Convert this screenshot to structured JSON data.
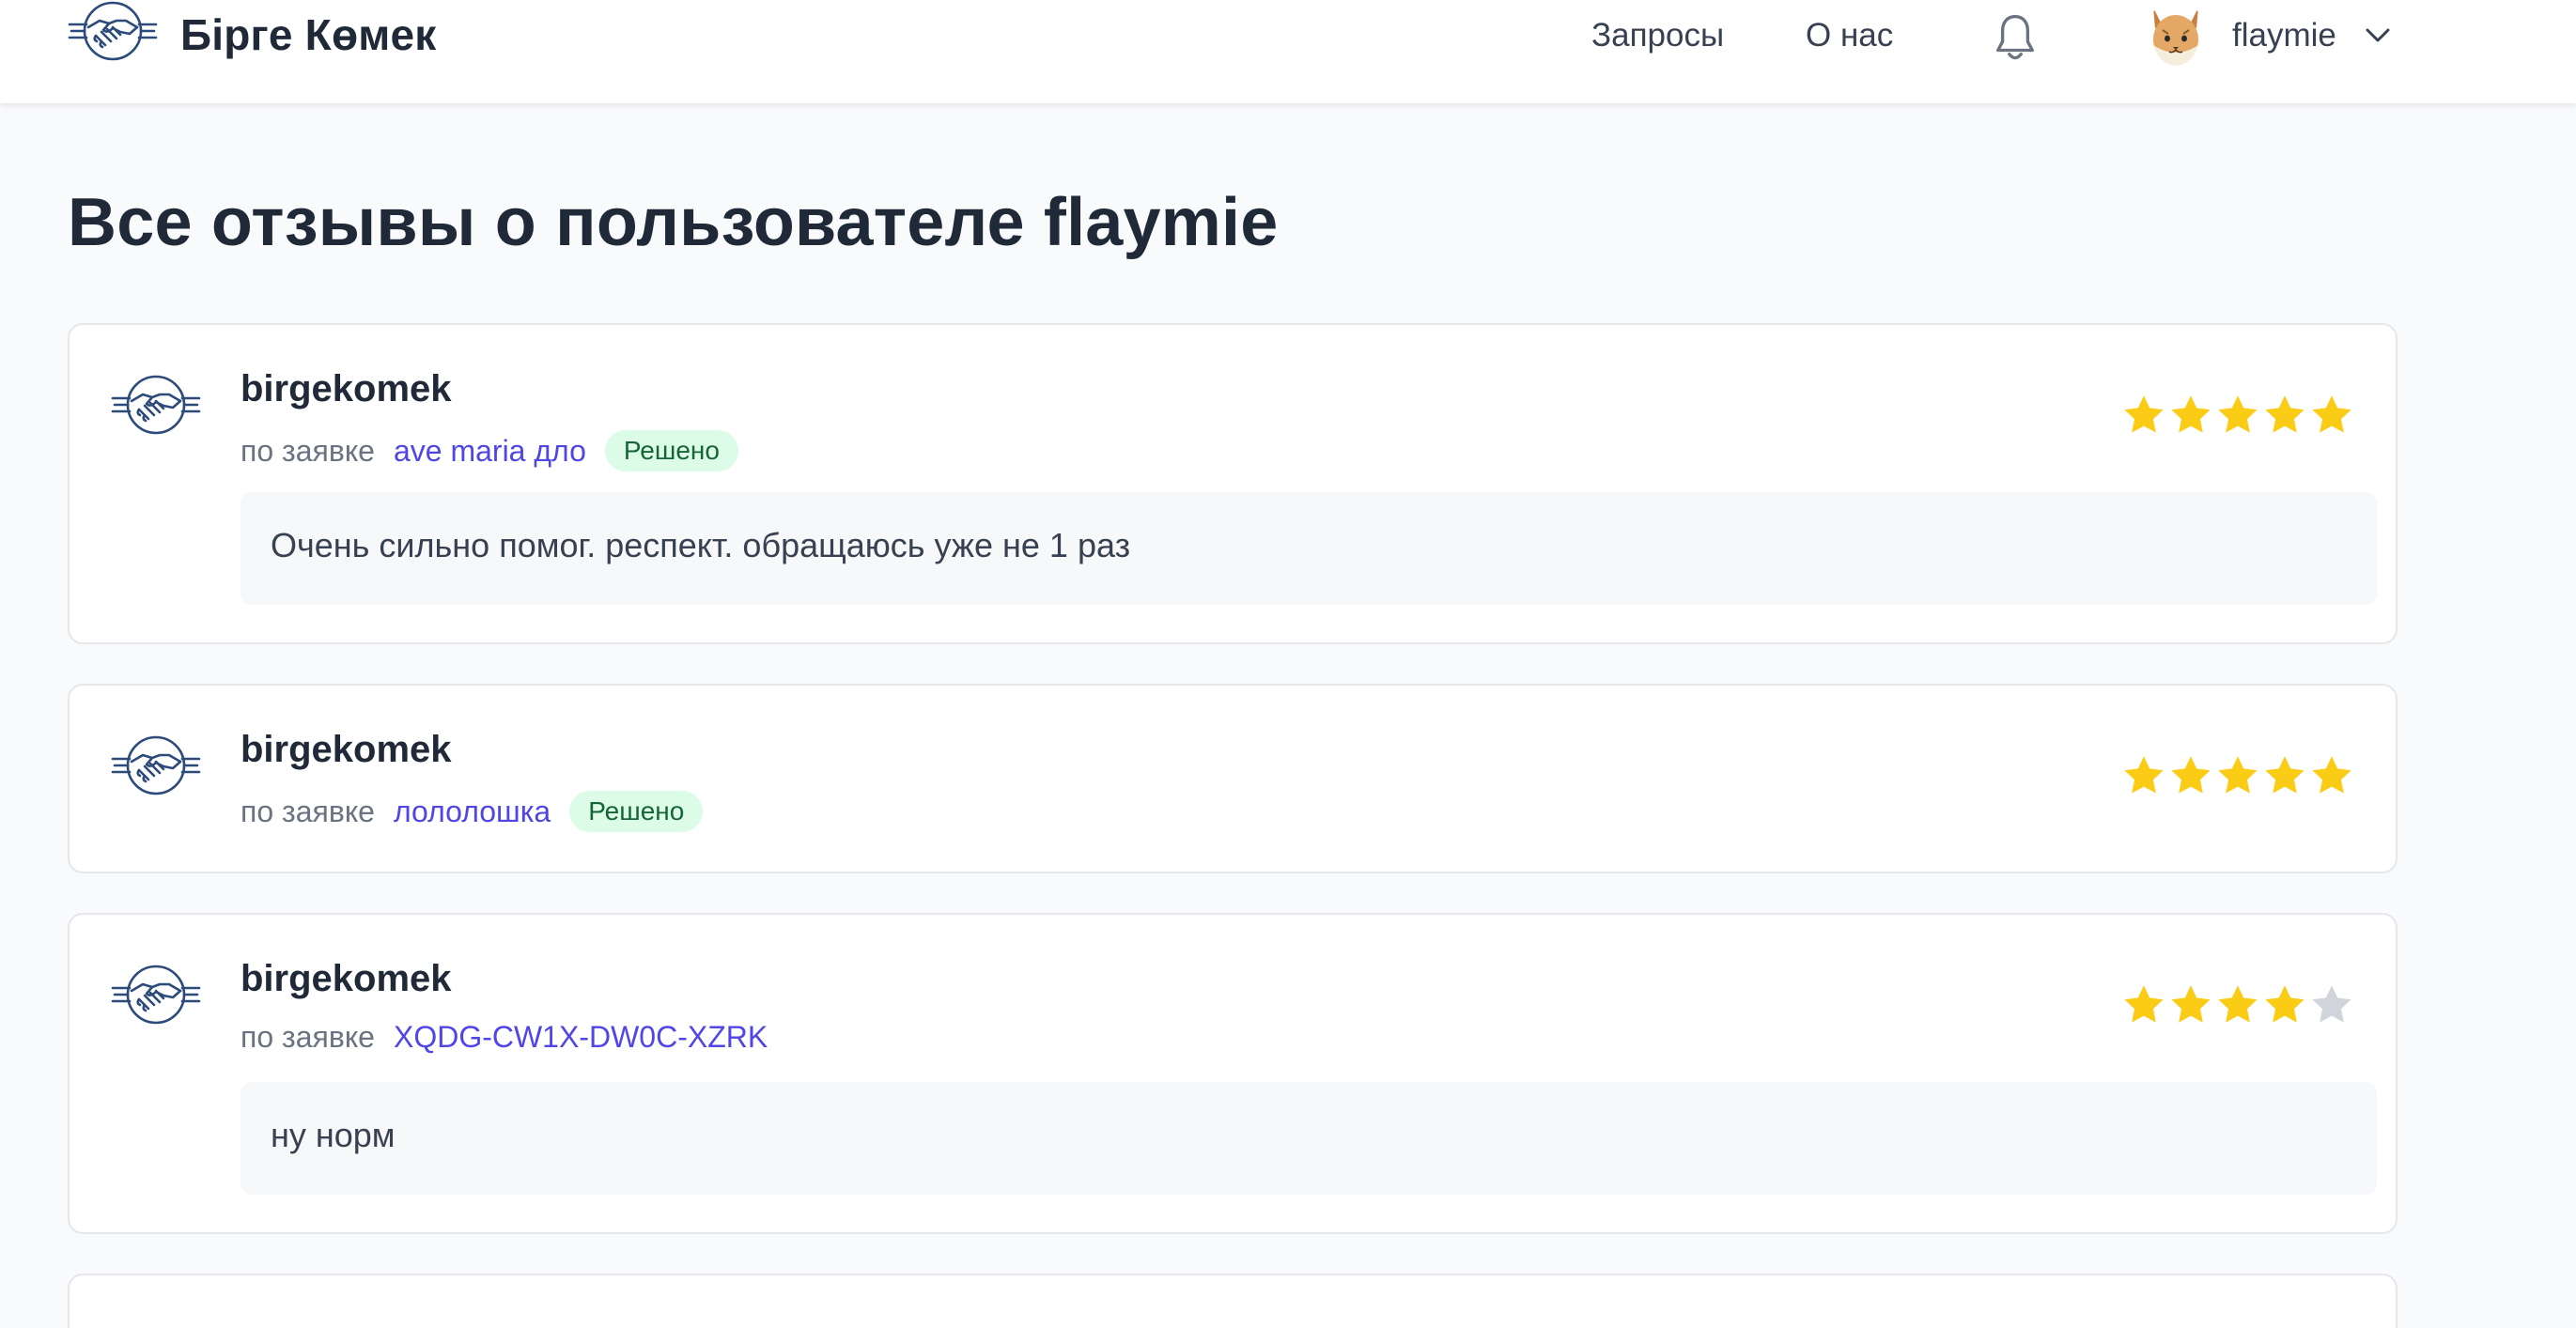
{
  "header": {
    "brand": "Бірге Көмек",
    "logo_icon": "handshake-logo-icon",
    "nav": [
      {
        "label": "Запросы"
      },
      {
        "label": "О нас"
      }
    ],
    "notification_icon": "bell-icon",
    "user": {
      "name": "flaymie",
      "avatar_icon": "lynx-avatar-icon",
      "menu_icon": "chevron-down-icon"
    }
  },
  "page": {
    "title": "Все отзывы о пользователе flaymie"
  },
  "colors": {
    "accent_link": "#4f46e5",
    "star_filled": "#facc15",
    "star_empty": "#d1d5db",
    "badge_bg": "#dcfce7",
    "badge_text": "#166534"
  },
  "reviews": [
    {
      "author": "birgekomek",
      "prefix": "по заявке",
      "request": "ave maria дло",
      "status": "Решено",
      "rating": 5,
      "max_rating": 5,
      "comment": "Очень сильно помог. респект. обращаюсь уже не 1 раз"
    },
    {
      "author": "birgekomek",
      "prefix": "по заявке",
      "request": "лололошка",
      "status": "Решено",
      "rating": 5,
      "max_rating": 5,
      "comment": ""
    },
    {
      "author": "birgekomek",
      "prefix": "по заявке",
      "request": "XQDG-CW1X-DW0C-XZRK",
      "status": "",
      "rating": 4,
      "max_rating": 5,
      "comment": "ну норм"
    }
  ]
}
